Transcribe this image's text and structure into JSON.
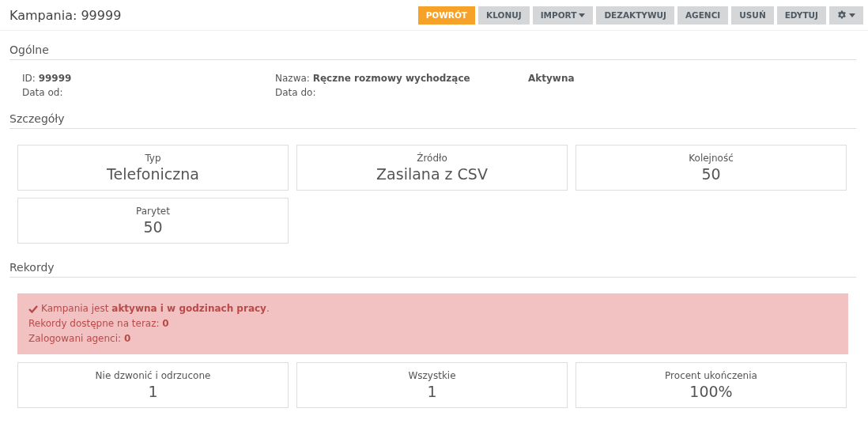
{
  "header": {
    "title": "Kampania: 99999",
    "buttons": [
      {
        "label": "POWRÓT",
        "kind": "primary",
        "dropdown": false
      },
      {
        "label": "KLONUJ",
        "kind": "default",
        "dropdown": false
      },
      {
        "label": "IMPORT",
        "kind": "default",
        "dropdown": true
      },
      {
        "label": "DEZAKTYWUJ",
        "kind": "default",
        "dropdown": false
      },
      {
        "label": "AGENCI",
        "kind": "default",
        "dropdown": false
      },
      {
        "label": "USUŃ",
        "kind": "default",
        "dropdown": false
      },
      {
        "label": "EDYTUJ",
        "kind": "default",
        "dropdown": false
      },
      {
        "kind": "gear",
        "dropdown": true
      }
    ]
  },
  "general": {
    "title": "Ogólne",
    "columns": [
      [
        "ID: **99999**",
        "Data od:"
      ],
      [
        "Nazwa: **Ręczne rozmowy wychodzące**",
        "Data do:"
      ]
    ],
    "status": "Aktywna"
  },
  "details": {
    "title": "Szczegóły",
    "cards": [
      {
        "label": "Typ",
        "value": "Telefoniczna"
      },
      {
        "label": "Źródło",
        "value": "Zasilana z CSV"
      },
      {
        "label": "Kolejność",
        "value": "50"
      },
      {
        "label": "Parytet",
        "value": "50"
      }
    ]
  },
  "records": {
    "title": "Rekordy",
    "alert": [
      "Kampania jest **aktywna i w godzinach pracy**.",
      "Rekordy dostępne na teraz: **0**",
      "Zalogowani agenci: **0**"
    ],
    "cards": [
      {
        "label": "Nie dzwonić i odrzucone",
        "value": "1"
      },
      {
        "label": "Wszystkie",
        "value": "1"
      },
      {
        "label": "Procent ukończenia",
        "value": "100%"
      }
    ]
  }
}
